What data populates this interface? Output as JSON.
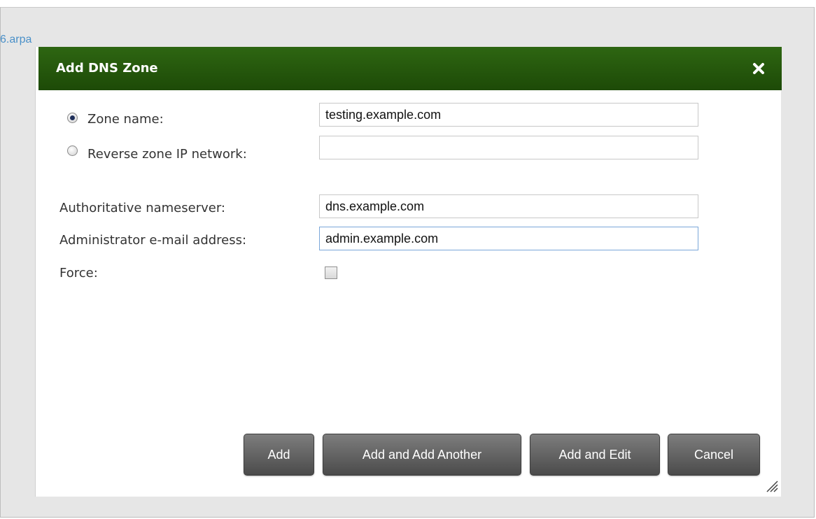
{
  "background": {
    "link_text": "6.arpa"
  },
  "dialog": {
    "title": "Add DNS Zone",
    "close_icon": "close-icon",
    "titlebar_color": "#245a0c"
  },
  "form": {
    "zone_name": {
      "label": "Zone name:",
      "selected": true,
      "value": "testing.example.com"
    },
    "reverse_zone": {
      "label": "Reverse zone IP network:",
      "selected": false,
      "value": ""
    },
    "nameserver": {
      "label": "Authoritative nameserver:",
      "value": "dns.example.com"
    },
    "admin_email": {
      "label": "Administrator e-mail address:",
      "value": "admin.example.com"
    },
    "force": {
      "label": "Force:",
      "checked": false
    }
  },
  "buttons": {
    "add": "Add",
    "add_another": "Add and Add Another",
    "add_edit": "Add and Edit",
    "cancel": "Cancel"
  }
}
